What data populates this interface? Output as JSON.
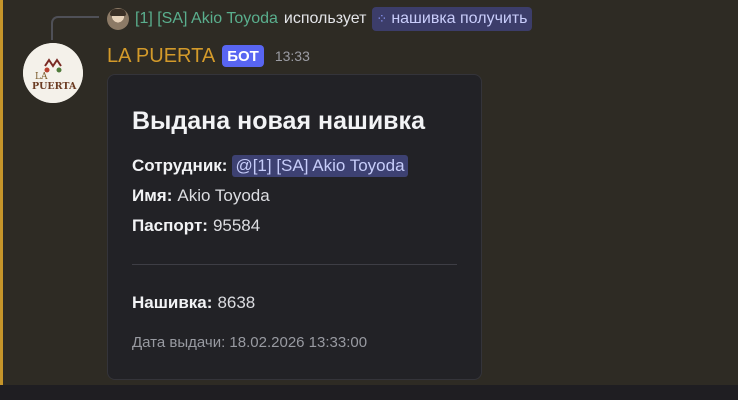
{
  "reply": {
    "user": "[1] [SA] Akio Toyoda",
    "uses_text": "использует",
    "command": "нашивка получить",
    "command_icon": "app-command-icon"
  },
  "message": {
    "author": "LA PUERTA",
    "badge": "БОТ",
    "time": "13:33",
    "avatar_text_top": "LA",
    "avatar_text_bottom": "PUERTA",
    "accent_color": "#c6952a"
  },
  "embed": {
    "title": "Выдана новая нашивка",
    "fields": {
      "employee_label": "Сотрудник:",
      "employee_mention": "@[1] [SA] Akio Toyoda",
      "name_label": "Имя:",
      "name_value": "Akio Toyoda",
      "passport_label": "Паспорт:",
      "passport_value": "95584",
      "patch_label": "Нашивка:",
      "patch_value": "8638"
    },
    "footer": "Дата выдачи: 18.02.2026 13:33:00"
  }
}
